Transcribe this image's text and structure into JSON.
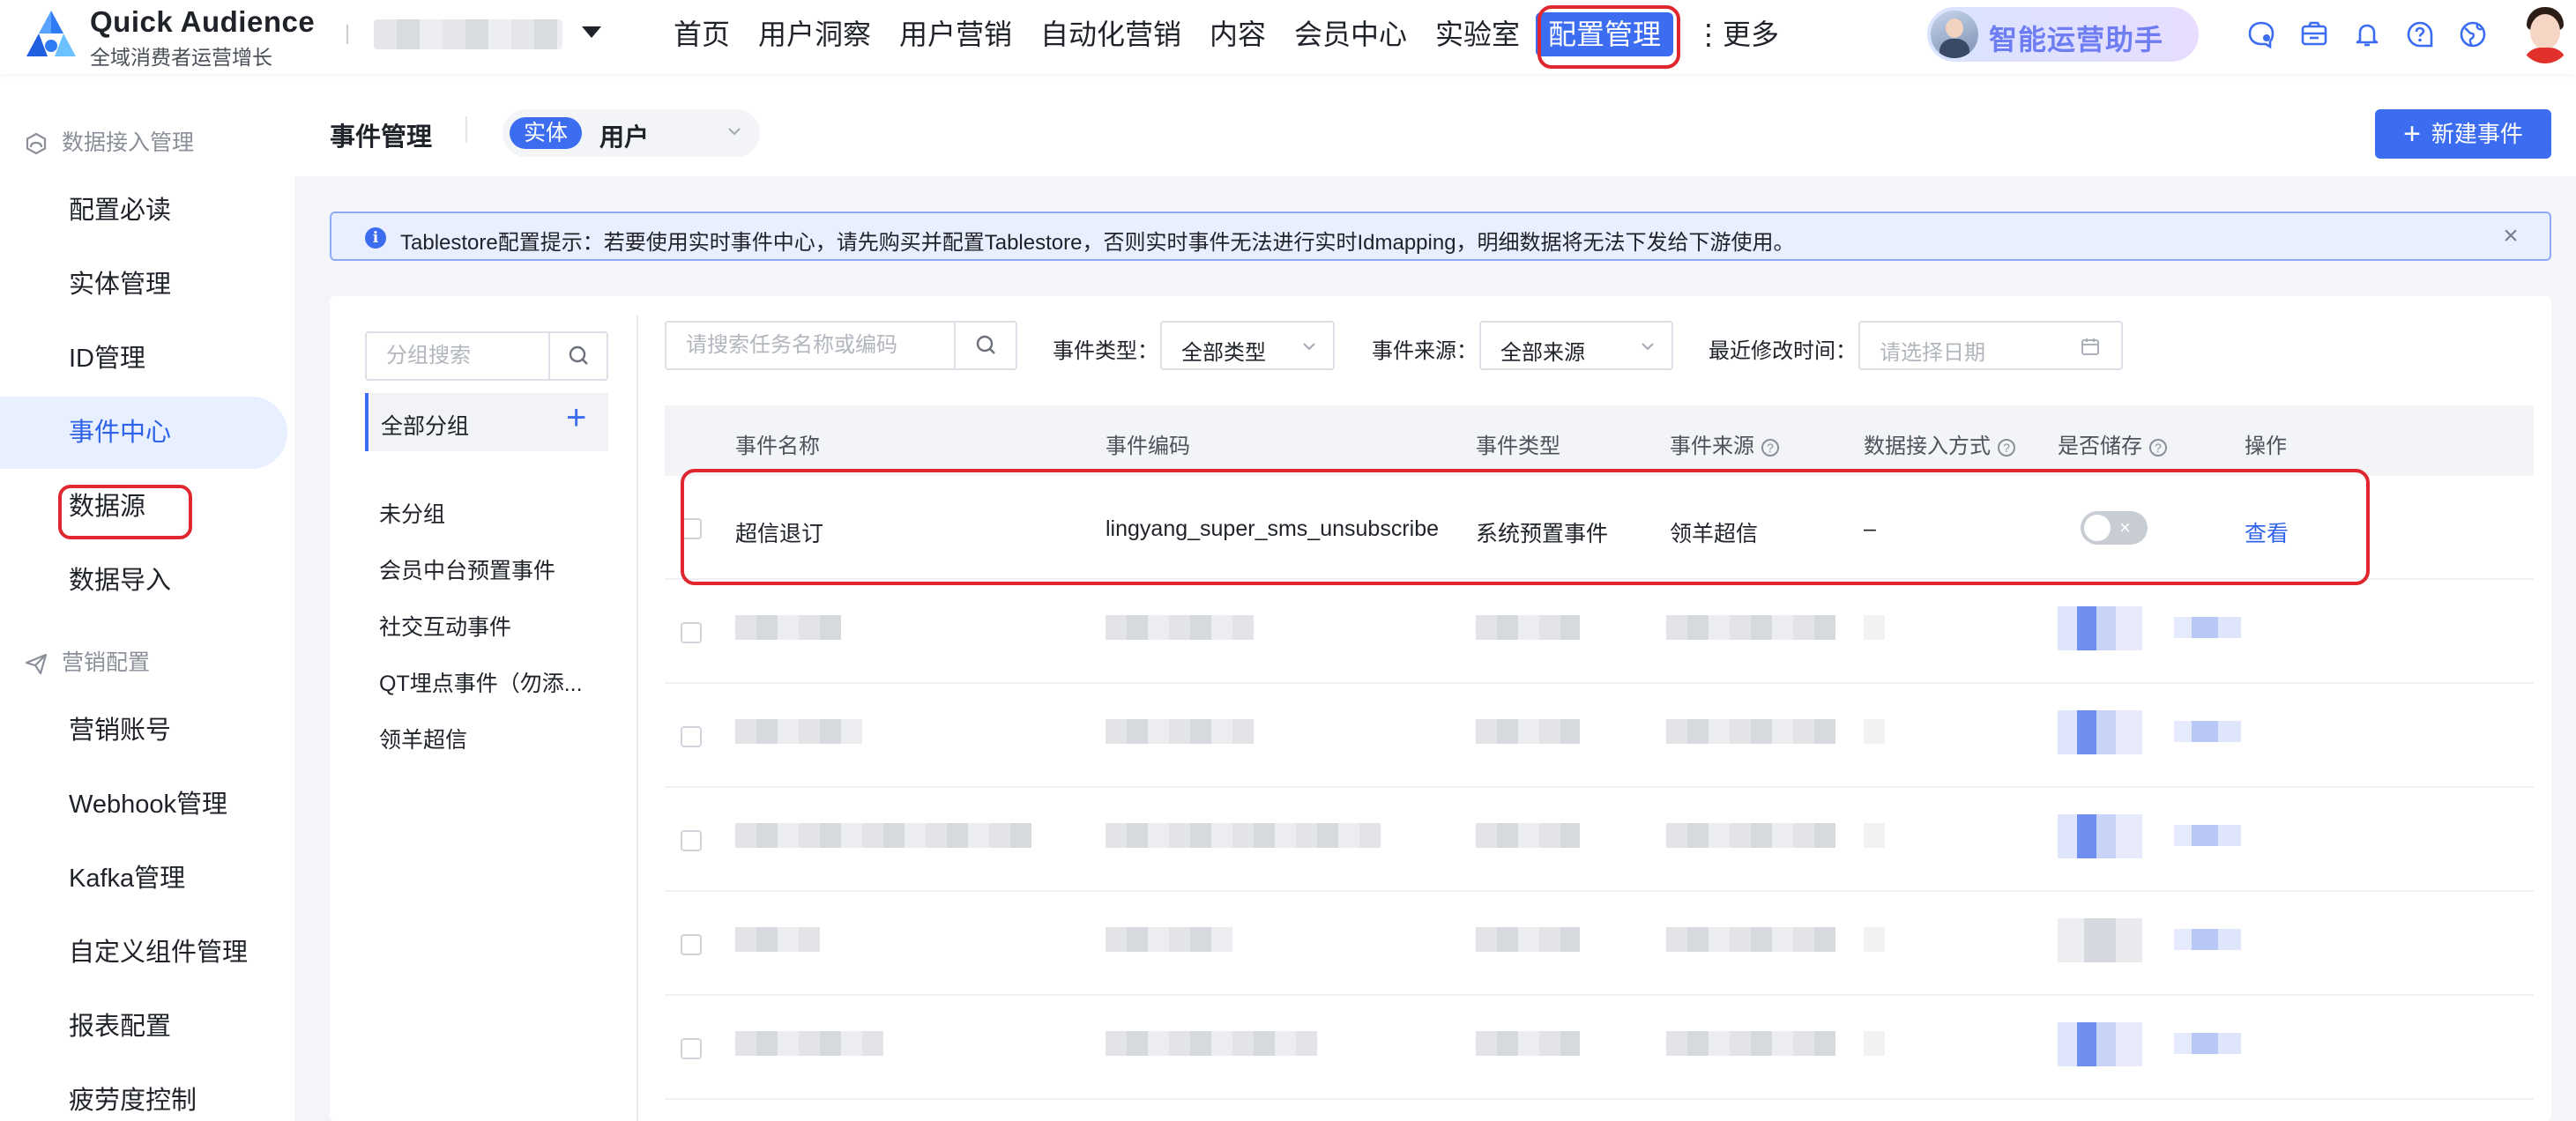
{
  "brand": {
    "title": "Quick Audience",
    "subtitle": "全域消费者运营增长"
  },
  "top_nav": [
    {
      "label": "首页"
    },
    {
      "label": "用户洞察"
    },
    {
      "label": "用户营销"
    },
    {
      "label": "自动化营销"
    },
    {
      "label": "内容"
    },
    {
      "label": "会员中心"
    },
    {
      "label": "实验室"
    },
    {
      "label": "配置管理",
      "active": true
    },
    {
      "label": "⋮更多"
    }
  ],
  "assistant": {
    "label": "智能运营助手"
  },
  "header_icons": [
    "ai-chat-icon",
    "message-box-icon",
    "bell-icon",
    "help-icon",
    "language-icon"
  ],
  "sidebar": {
    "groups": [
      {
        "title": "数据接入管理",
        "icon": "cloud-icon",
        "items": [
          "配置必读",
          "实体管理",
          "ID管理",
          "事件中心",
          "数据源",
          "数据导入"
        ]
      },
      {
        "title": "营销配置",
        "icon": "send-icon",
        "items": [
          "营销账号",
          "Webhook管理",
          "Kafka管理",
          "自定义组件管理",
          "报表配置",
          "疲劳度控制"
        ]
      }
    ],
    "active_item": "事件中心"
  },
  "content_header": {
    "title": "事件管理",
    "entity_tag": "实体",
    "entity_value": "用户",
    "new_button": "新建事件"
  },
  "alert": {
    "text": "Tablestore配置提示：若要使用实时事件中心，请先购买并配置Tablestore，否则实时事件无法进行实时Idmapping，明细数据将无法下发给下游使用。"
  },
  "groups_panel": {
    "search_placeholder": "分组搜索",
    "all_label": "全部分组",
    "items": [
      "未分组",
      "会员中台预置事件",
      "社交互动事件",
      "QT埋点事件（勿添...",
      "领羊超信"
    ]
  },
  "filters": {
    "search_placeholder": "请搜索任务名称或编码",
    "type_label": "事件类型：",
    "type_value": "全部类型",
    "source_label": "事件来源：",
    "source_value": "全部来源",
    "date_label": "最近修改时间：",
    "date_placeholder": "请选择日期"
  },
  "table": {
    "columns": [
      "事件名称",
      "事件编码",
      "事件类型",
      "事件来源",
      "数据接入方式",
      "是否储存",
      "操作"
    ],
    "rows": [
      {
        "name": "超信退订",
        "code": "lingyang_super_sms_unsubscribe",
        "type": "系统预置事件",
        "source": "领羊超信",
        "access": "–",
        "stored": false,
        "action": "查看"
      }
    ]
  },
  "colors": {
    "primary": "#3c6cf0",
    "highlight": "#e0262f",
    "active_bg": "#e8efff"
  }
}
